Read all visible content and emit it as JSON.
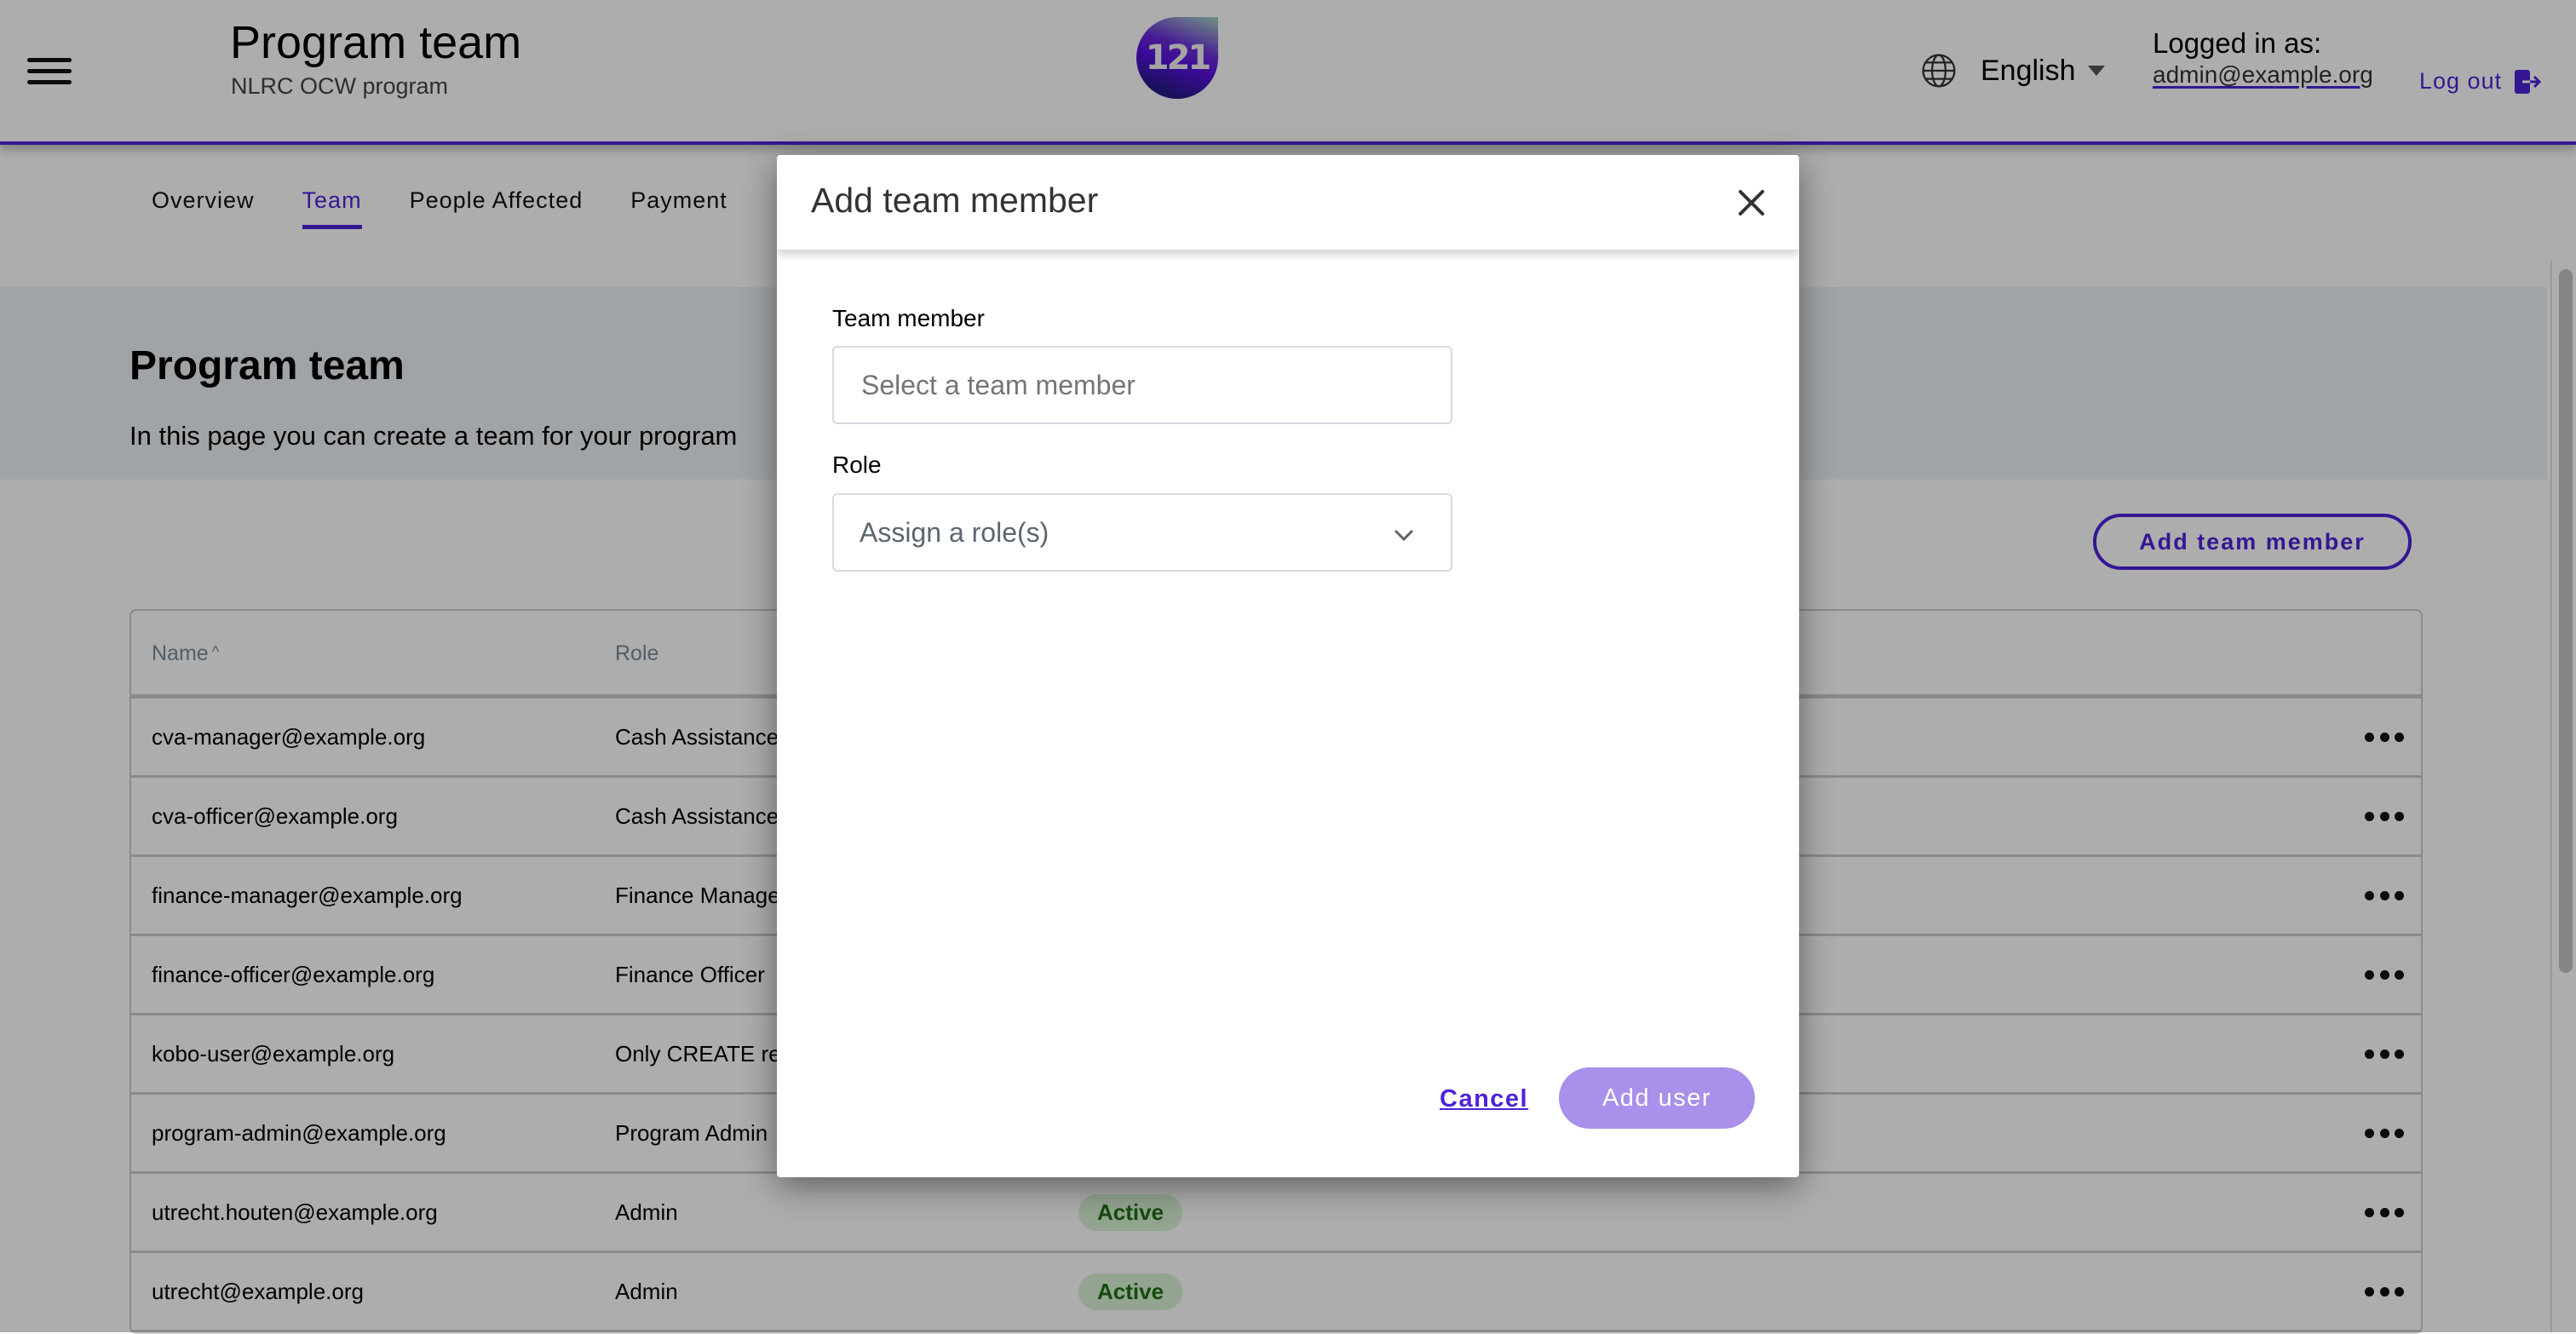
{
  "header": {
    "title": "Program team",
    "subtitle": "NLRC OCW program",
    "logo_text": "121",
    "language": "English",
    "logged_in_label": "Logged in as:",
    "logged_in_email": "admin@example.org",
    "logout_label": "Log out"
  },
  "tabs": [
    {
      "label": "Overview",
      "active": false
    },
    {
      "label": "Team",
      "active": true
    },
    {
      "label": "People Affected",
      "active": false
    },
    {
      "label": "Payment",
      "active": false
    }
  ],
  "page": {
    "title": "Program team",
    "description": "In this page you can create a team for your program",
    "add_button_label": "Add team member"
  },
  "table": {
    "columns": {
      "name": "Name",
      "name_sort": "^",
      "role": "Role"
    },
    "rows": [
      {
        "name": "cva-manager@example.org",
        "role": "Cash Assistance",
        "status": ""
      },
      {
        "name": "cva-officer@example.org",
        "role": "Cash Assistance",
        "status": ""
      },
      {
        "name": "finance-manager@example.org",
        "role": "Finance Manage",
        "status": ""
      },
      {
        "name": "finance-officer@example.org",
        "role": "Finance Officer",
        "status": ""
      },
      {
        "name": "kobo-user@example.org",
        "role": "Only CREATE re",
        "status": ""
      },
      {
        "name": "program-admin@example.org",
        "role": "Program Admin",
        "status": ""
      },
      {
        "name": "utrecht.houten@example.org",
        "role": "Admin",
        "status": "Active"
      },
      {
        "name": "utrecht@example.org",
        "role": "Admin",
        "status": "Active"
      }
    ]
  },
  "modal": {
    "title": "Add team member",
    "team_member_label": "Team member",
    "team_member_placeholder": "Select a team member",
    "team_member_value": "",
    "role_label": "Role",
    "role_placeholder": "Assign a role(s)",
    "cancel_label": "Cancel",
    "submit_label": "Add user"
  },
  "colors": {
    "accent": "#4f22d7",
    "badge_active_bg": "#d9f2d4",
    "badge_active_text": "#1f6f14",
    "submit_disabled": "#a990ea"
  }
}
